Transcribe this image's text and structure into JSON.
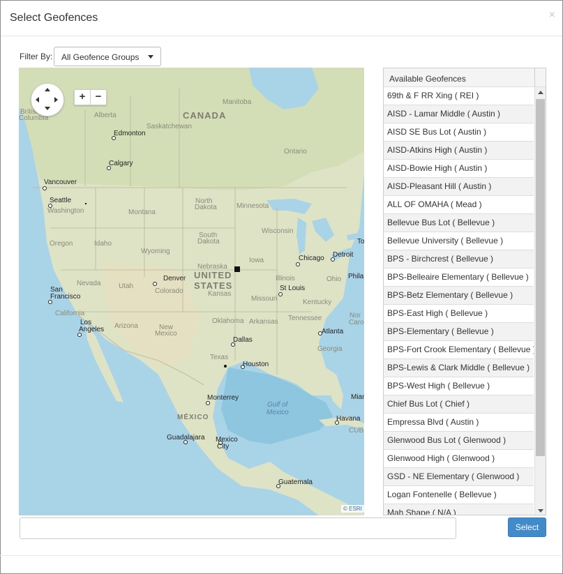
{
  "modal": {
    "title": "Select Geofences",
    "close_glyph": "×"
  },
  "filter": {
    "label": "Filter By:",
    "selected": "All Geofence Groups"
  },
  "map": {
    "zoom_in": "+",
    "zoom_out": "−",
    "attribution": "© ESRI",
    "labels": {
      "canada": "CANADA",
      "united_states_1": "UNITED",
      "united_states_2": "STATES",
      "mexico": "MÉXICO",
      "gulf_1": "Gulf of",
      "gulf_2": "Mexico",
      "british_columbia_1": "British",
      "british_columbia_2": "Columbia",
      "alberta": "Alberta",
      "saskatchewan": "Saskatchewan",
      "manitoba": "Manitoba",
      "ontario": "Ontario",
      "washington": "Washington",
      "montana": "Montana",
      "north_dakota_1": "North",
      "north_dakota_2": "Dakota",
      "south_dakota_1": "South",
      "south_dakota_2": "Dakota",
      "minnesota": "Minnesota",
      "wisconsin": "Wisconsin",
      "oregon": "Oregon",
      "idaho": "Idaho",
      "wyoming": "Wyoming",
      "nebraska": "Nebraska",
      "iowa": "Iowa",
      "nevada": "Nevada",
      "utah": "Utah",
      "colorado": "Colorado",
      "kansas": "Kansas",
      "missouri": "Missouri",
      "illinois": "Illinois",
      "ohio": "Ohio",
      "kentucky": "Kentucky",
      "california": "California",
      "arizona": "Arizona",
      "new_mexico_1": "New",
      "new_mexico_2": "Mexico",
      "oklahoma": "Oklahoma",
      "arkansas": "Arkansas",
      "tennessee": "Tennessee",
      "texas": "Texas",
      "georgia": "Georgia",
      "cuba": "CUB",
      "north_carolina": "Nor",
      "carolina": "Caro"
    },
    "cities": {
      "edmonton": "Edmonton",
      "calgary": "Calgary",
      "vancouver": "Vancouver",
      "seattle": "Seattle",
      "denver": "Denver",
      "chicago": "Chicago",
      "detroit": "Detroit",
      "toronto": "To",
      "philadelphia": "Phila",
      "san_francisco_1": "San",
      "san_francisco_2": "Francisco",
      "los_angeles_1": "Los",
      "los_angeles_2": "Angeles",
      "st_louis": "St Louis",
      "atlanta": "Atlanta",
      "dallas": "Dallas",
      "houston": "Houston",
      "miami": "Miam",
      "monterrey": "Monterrey",
      "havana": "Havana",
      "guadalajara": "Guadalajara",
      "mexico_city_1": "Mexico",
      "mexico_city_2": "City",
      "guatemala": "Guatemala"
    }
  },
  "geofence_list": {
    "header": "Available Geofences",
    "items": [
      "69th & F RR Xing ( REI )",
      "AISD - Lamar Middle ( Austin )",
      "AISD SE Bus Lot ( Austin )",
      "AISD-Atkins High ( Austin )",
      "AISD-Bowie High ( Austin )",
      "AISD-Pleasant Hill ( Austin )",
      "ALL OF OMAHA ( Mead )",
      "Bellevue Bus Lot ( Bellevue )",
      "Bellevue University ( Bellevue )",
      "BPS - Birchcrest ( Bellevue )",
      "BPS-Belleaire Elementary ( Bellevue )",
      "BPS-Betz Elementary ( Bellevue )",
      "BPS-East High ( Bellevue )",
      "BPS-Elementary ( Bellevue )",
      "BPS-Fort Crook Elementary ( Bellevue )",
      "BPS-Lewis & Clark Middle ( Bellevue )",
      "BPS-West High ( Bellevue )",
      "Chief Bus Lot ( Chief )",
      "Empressa Blvd ( Austin )",
      "Glenwood Bus Lot ( Glenwood )",
      "Glenwood High ( Glenwood )",
      "GSD - NE Elementary ( Glenwood )",
      "Logan Fontenelle ( Bellevue )",
      "Mah Shape ( N/A )"
    ]
  },
  "search_input": {
    "value": "",
    "placeholder": ""
  },
  "actions": {
    "select_label": "Select"
  },
  "colors": {
    "primary": "#428bca",
    "water": "#a9d3e6",
    "land": "#dfe3c6"
  }
}
